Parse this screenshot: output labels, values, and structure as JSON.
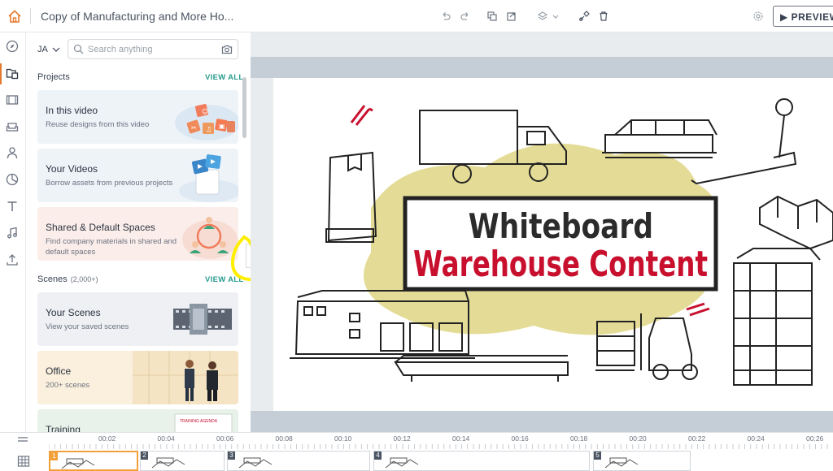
{
  "header": {
    "project_title": "Copy of Manufacturing and More Ho...",
    "preview_label": "PREVIEW",
    "tools": [
      "undo-icon",
      "redo-icon",
      "copy-icon",
      "paste-icon",
      "layers-icon",
      "brush-icon",
      "trash-icon",
      "gear-icon"
    ]
  },
  "rail": {
    "items": [
      "compass-icon",
      "folder-icon",
      "film-icon",
      "sofa-icon",
      "person-icon",
      "chart-icon",
      "text-icon",
      "music-icon",
      "upload-icon"
    ],
    "active_index": 1
  },
  "panel": {
    "language": "JA",
    "search_placeholder": "Search anything",
    "projects_heading": "Projects",
    "projects_view_all": "VIEW ALL",
    "project_cards": [
      {
        "title": "In this video",
        "subtitle": "Reuse designs from this video"
      },
      {
        "title": "Your Videos",
        "subtitle": "Borrow assets from previous projects"
      },
      {
        "title": "Shared & Default Spaces",
        "subtitle": "Find company materials in shared and default spaces"
      }
    ],
    "scenes_heading": "Scenes",
    "scenes_count": "(2,000+)",
    "scenes_view_all": "VIEW ALL",
    "scene_cards": [
      {
        "title": "Your Scenes",
        "subtitle": "View your saved scenes"
      },
      {
        "title": "Office",
        "subtitle": "200+ scenes"
      },
      {
        "title": "Training",
        "subtitle": ""
      }
    ],
    "training_sign": "TRAINING AGENDA"
  },
  "slide": {
    "title_line1": "Whiteboard",
    "title_line2": "Warehouse Content"
  },
  "timeline": {
    "tick_labels": [
      "00:02",
      "00:04",
      "00:06",
      "00:08",
      "00:10",
      "00:12",
      "00:14",
      "00:16",
      "00:18",
      "00:20",
      "00:22",
      "00:24",
      "00:26"
    ],
    "scene_numbers": [
      "1",
      "2",
      "3",
      "4",
      "5"
    ],
    "selected_scene": "1"
  },
  "colors": {
    "accent_orange": "#e47a2e",
    "teal_link": "#2a9d8f",
    "title_red": "#c8102e",
    "highlight_yellow": "#ffee00"
  }
}
